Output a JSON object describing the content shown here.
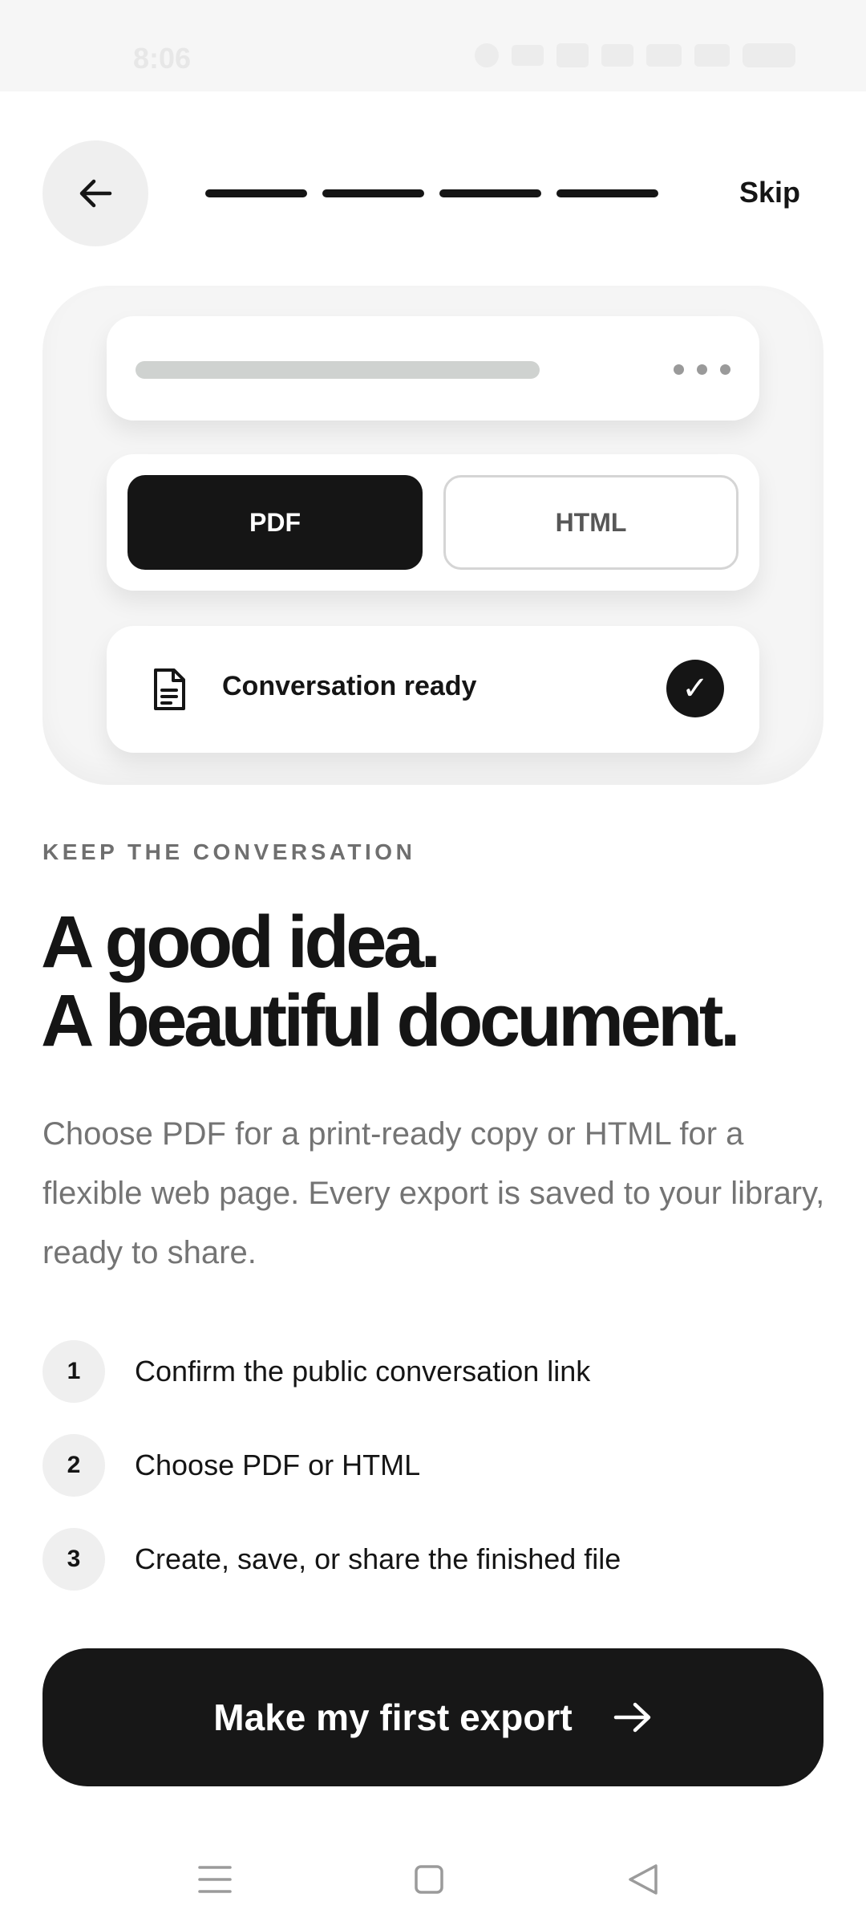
{
  "status_bar": {
    "time": "8:06"
  },
  "header": {
    "skip_label": "Skip",
    "progress_steps": 4
  },
  "illustration": {
    "format_options": [
      "PDF",
      "HTML"
    ],
    "selected_format": "PDF",
    "status_text": "Conversation ready"
  },
  "content": {
    "eyebrow": "KEEP THE CONVERSATION",
    "headline_line1": "A good idea.",
    "headline_line2": "A beautiful document.",
    "description": "Choose PDF for a print-ready copy or HTML for a flexible web page. Every export is saved to your library, ready to share."
  },
  "steps": [
    {
      "number": "1",
      "text": "Confirm the public conversation link"
    },
    {
      "number": "2",
      "text": "Choose PDF or HTML"
    },
    {
      "number": "3",
      "text": "Create, save, or share the finished file"
    }
  ],
  "cta": {
    "label": "Make my first export"
  },
  "colors": {
    "primary": "#151515",
    "surface": "#f5f5f5",
    "muted_text": "#747474"
  }
}
